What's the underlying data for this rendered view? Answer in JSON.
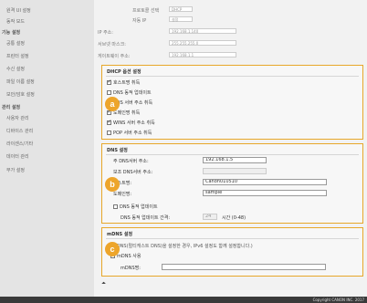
{
  "sidebar": {
    "items": [
      {
        "label": "원격 UI 설정"
      },
      {
        "label": "동작 모드"
      },
      {
        "label": "기능 설정"
      },
      {
        "label": "공통 설정"
      },
      {
        "label": "프린터 설정"
      },
      {
        "label": "수신 설정"
      },
      {
        "label": "파일 이름 설정"
      },
      {
        "label": "보안/암호 설정"
      },
      {
        "label": "관리 설정"
      },
      {
        "label": "사용자 관리"
      },
      {
        "label": "디바이스 관리"
      },
      {
        "label": "라이센스/기타"
      },
      {
        "label": "데이터 관리"
      },
      {
        "label": "부가 설정"
      }
    ]
  },
  "top": {
    "protocol_label": "프로토콜 선택",
    "protocol_value": "DHCP",
    "autoip_label": "자동 IP",
    "autoip_value": "설정",
    "ip_label": "IP 주소:",
    "ip_value": "192.168.1.140",
    "subnet_label": "서브넷 마스크:",
    "subnet_value": "255.255.255.0",
    "gateway_label": "게이트웨이 주소:",
    "gateway_value": "192.168.1.1"
  },
  "dhcp": {
    "marker": "a",
    "title": "DHCP 옵션 설정",
    "options": [
      {
        "label": "호스트명 취득",
        "checked": true
      },
      {
        "label": "DNS 동적 업데이트",
        "checked": false
      },
      {
        "label": "DNS 서버 주소 취득",
        "checked": true
      },
      {
        "label": "도메인명 취득",
        "checked": true
      },
      {
        "label": "WINS 서버 주소 취득",
        "checked": true
      },
      {
        "label": "POP 서버 주소 취득",
        "checked": false
      }
    ]
  },
  "dns": {
    "marker": "b",
    "title": "DNS 설정",
    "primary_label": "주 DNS서버 주소:",
    "primary_value": "192.168.1.5",
    "secondary_label": "보조 DNS서버 주소:",
    "secondary_value": "",
    "host_label": "호스트명:",
    "host_value": "Canon010510",
    "domain_label": "도메인명:",
    "domain_value": "sample",
    "dyn_update_label": "DNS 동적 업데이트",
    "interval_label": "DNS 동적 업데이트 간격:",
    "interval_value": "24",
    "interval_unit": "시간 (0-48)"
  },
  "mdns": {
    "marker": "c",
    "title": "mDNS 설정",
    "note": "(mDNS(멀티캐스트 DNS)을 설정한 경우, IPv6 설정도 함께 설정합니다.)",
    "use_label": "mDNS 사용",
    "name_label": "mDNS명:",
    "name_value": ""
  },
  "footer": {
    "copyright": "Copyright CANON INC. 2017"
  },
  "colors": {
    "accent": "#eda52b",
    "sidebar_bg": "#e4e4e4",
    "main_bg": "#f2f2f2",
    "footer_bg": "#3a3a3a"
  }
}
